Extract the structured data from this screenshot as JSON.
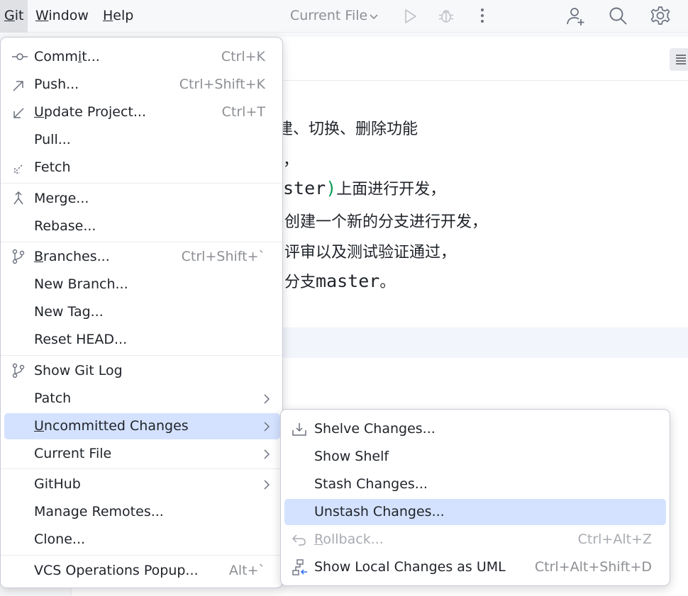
{
  "menubar": {
    "git": {
      "mnemonic": "G",
      "rest": "it"
    },
    "window": {
      "mnemonic": "W",
      "rest": "indow"
    },
    "help": {
      "mnemonic": "H",
      "rest": "elp"
    }
  },
  "toolbar": {
    "run_config": "Current File",
    "icons": [
      "chevron-down-icon",
      "run-icon",
      "debug-icon",
      "more-vertical-icon",
      "add-user-icon",
      "search-icon",
      "settings-icon"
    ]
  },
  "editor": {
    "line1": "建、切换、删除功能",
    "line2": "，",
    "line3_code": "ster",
    "line3_paren": ")",
    "line3_text": "上面进行开发，",
    "line4": "创建一个新的分支进行开发，",
    "line5": "评审以及测试验证通过，",
    "line6_text": "分支",
    "line6_code": "master",
    "line6_end": "。"
  },
  "git_menu": {
    "commit": {
      "before": "Comm",
      "mnemonic": "i",
      "after": "t...",
      "shortcut": "Ctrl+K",
      "icon": "commit-icon"
    },
    "push": {
      "label": "Push...",
      "shortcut": "Ctrl+Shift+K",
      "icon": "push-arrow-icon"
    },
    "update_project": {
      "mnemonic": "U",
      "after": "pdate Project...",
      "shortcut": "Ctrl+T",
      "icon": "update-arrow-icon"
    },
    "pull": {
      "label": "Pull..."
    },
    "fetch": {
      "label": "Fetch",
      "icon": "fetch-icon"
    },
    "merge": {
      "label": "Merge...",
      "icon": "merge-icon"
    },
    "rebase": {
      "label": "Rebase..."
    },
    "branches": {
      "mnemonic": "B",
      "after": "ranches...",
      "shortcut": "Ctrl+Shift+`",
      "icon": "branch-icon"
    },
    "new_branch": {
      "label": "New Branch..."
    },
    "new_tag": {
      "label": "New Tag..."
    },
    "reset_head": {
      "label": "Reset HEAD..."
    },
    "show_git_log": {
      "label": "Show Git Log",
      "icon": "git-log-icon"
    },
    "patch": {
      "label": "Patch"
    },
    "uncommitted_changes": {
      "mnemonic": "U",
      "after": "ncommitted Changes"
    },
    "current_file": {
      "label": "Current File"
    },
    "github": {
      "label": "GitHub"
    },
    "manage_remotes": {
      "label": "Manage Remotes..."
    },
    "clone": {
      "label": "Clone..."
    },
    "vcs_popup": {
      "label": "VCS Operations Popup...",
      "shortcut": "Alt+`"
    }
  },
  "uncommitted_submenu": {
    "shelve": {
      "label": "Shelve Changes...",
      "icon": "shelve-icon"
    },
    "show_shelf": {
      "label": "Show Shelf"
    },
    "stash": {
      "label": "Stash Changes..."
    },
    "unstash": {
      "label": "Unstash Changes..."
    },
    "rollback": {
      "mnemonic": "R",
      "after": "ollback...",
      "shortcut": "Ctrl+Alt+Z",
      "icon": "rollback-icon",
      "enabled": false
    },
    "uml": {
      "label": "Show Local Changes as UML",
      "shortcut": "Ctrl+Alt+Shift+D",
      "icon": "uml-diagram-icon"
    }
  },
  "colors": {
    "selection": "#d4e2ff",
    "shortcut_text": "#8c8f94",
    "disabled_text": "#a8abb2",
    "code_paren": "#0f9d58"
  }
}
